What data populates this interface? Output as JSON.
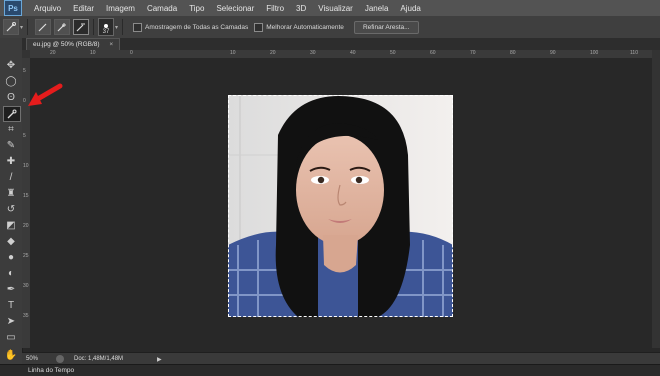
{
  "app": {
    "logo": "Ps",
    "menu": [
      "Arquivo",
      "Editar",
      "Imagem",
      "Camada",
      "Tipo",
      "Selecionar",
      "Filtro",
      "3D",
      "Visualizar",
      "Janela",
      "Ajuda"
    ]
  },
  "options_bar": {
    "brush_size": "37",
    "sample_all_layers_label": "Amostragem de Todas as Camadas",
    "auto_enhance_label": "Melhorar Automaticamente",
    "refine_edge_label": "Refinar Aresta..."
  },
  "document": {
    "tab_title": "eu.jpg @ 50% (RGB/8)",
    "close_glyph": "×"
  },
  "rulers": {
    "top": [
      "20",
      "10",
      "0",
      "10",
      "20",
      "30",
      "40",
      "50",
      "60",
      "70",
      "80",
      "90",
      "100",
      "110"
    ],
    "left": [
      "5",
      "0",
      "5",
      "10",
      "15",
      "20",
      "25",
      "30",
      "35"
    ]
  },
  "status_bar": {
    "zoom": "50%",
    "doc_size": "Doc: 1,48M/1,48M",
    "arrow": "▶"
  },
  "timeline": {
    "label": "Linha do Tempo"
  },
  "colors": {
    "accent_arrow": "#e51c1c",
    "workspace": "#282828",
    "menubar": "#535353"
  },
  "icons": [
    "move-icon",
    "ellipse-marquee-icon",
    "lasso-icon",
    "quick-selection-icon",
    "crop-icon",
    "eyedropper-icon",
    "healing-brush-icon",
    "brush-icon",
    "clone-stamp-icon",
    "history-brush-icon",
    "eraser-icon",
    "paint-bucket-icon",
    "blur-icon",
    "dodge-icon",
    "pen-icon",
    "type-icon",
    "path-selection-icon",
    "rectangle-shape-icon",
    "hand-icon"
  ]
}
